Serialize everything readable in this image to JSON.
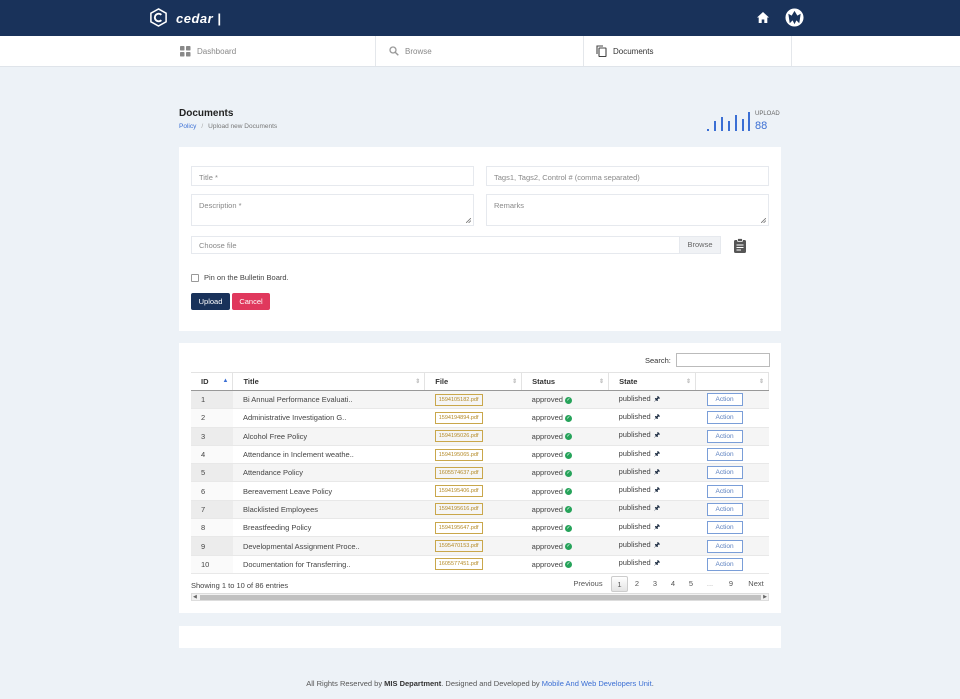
{
  "app": {
    "brand": "cedar |"
  },
  "nav": {
    "items": [
      {
        "label": "Dashboard",
        "icon": "grid-icon"
      },
      {
        "label": "Browse",
        "icon": "search-icon"
      },
      {
        "label": "Documents",
        "icon": "copy-icon"
      }
    ],
    "active": "Documents"
  },
  "page": {
    "title": "Documents",
    "breadcrumb": [
      "Policy",
      "Upload new Documents"
    ]
  },
  "stat": {
    "label": "UPLOAD",
    "count": "88",
    "color": "#3b6fd4"
  },
  "form": {
    "title_placeholder": "Title *",
    "tags_placeholder": "Tags1, Tags2, Control # (comma separated)",
    "description_placeholder": "Description *",
    "remarks_placeholder": "Remarks",
    "file_placeholder": "Choose file",
    "browse_label": "Browse",
    "pin_label": "Pin on the Bulletin Board.",
    "upload_label": "Upload",
    "cancel_label": "Cancel"
  },
  "table": {
    "search_label": "Search:",
    "columns": [
      "ID",
      "Title",
      "File",
      "Status",
      "State",
      ""
    ],
    "rows": [
      {
        "id": "1",
        "title": "Bi Annual Performance Evaluati..",
        "file": "1594105182.pdf",
        "status": "approved",
        "state": "published",
        "action": "Action"
      },
      {
        "id": "2",
        "title": "Administrative Investigation G..",
        "file": "1594194894.pdf",
        "status": "approved",
        "state": "published",
        "action": "Action"
      },
      {
        "id": "3",
        "title": "Alcohol Free Policy",
        "file": "1594195026.pdf",
        "status": "approved",
        "state": "published",
        "action": "Action"
      },
      {
        "id": "4",
        "title": "Attendance in Inclement weathe..",
        "file": "1594195065.pdf",
        "status": "approved",
        "state": "published",
        "action": "Action"
      },
      {
        "id": "5",
        "title": "Attendance Policy",
        "file": "1605574637.pdf",
        "status": "approved",
        "state": "published",
        "action": "Action"
      },
      {
        "id": "6",
        "title": "Bereavement Leave Policy",
        "file": "1594195406.pdf",
        "status": "approved",
        "state": "published",
        "action": "Action"
      },
      {
        "id": "7",
        "title": "Blacklisted Employees",
        "file": "1594195616.pdf",
        "status": "approved",
        "state": "published",
        "action": "Action"
      },
      {
        "id": "8",
        "title": "Breastfeeding Policy",
        "file": "1594195647.pdf",
        "status": "approved",
        "state": "published",
        "action": "Action"
      },
      {
        "id": "9",
        "title": "Developmental Assignment Proce..",
        "file": "1595470153.pdf",
        "status": "approved",
        "state": "published",
        "action": "Action"
      },
      {
        "id": "10",
        "title": "Documentation for Transferring..",
        "file": "1605577451.pdf",
        "status": "approved",
        "state": "published",
        "action": "Action"
      }
    ],
    "showing": "Showing 1 to 10 of 86 entries",
    "pagination": [
      "Previous",
      "1",
      "2",
      "3",
      "4",
      "5",
      "...",
      "9",
      "Next"
    ],
    "current_page": "1"
  },
  "footer": {
    "prefix": "All Rights Reserved by",
    "dept": "MIS Department",
    "middle": ". Designed and Developed by",
    "unit": "Mobile And Web Developers Unit",
    "suffix": "."
  }
}
